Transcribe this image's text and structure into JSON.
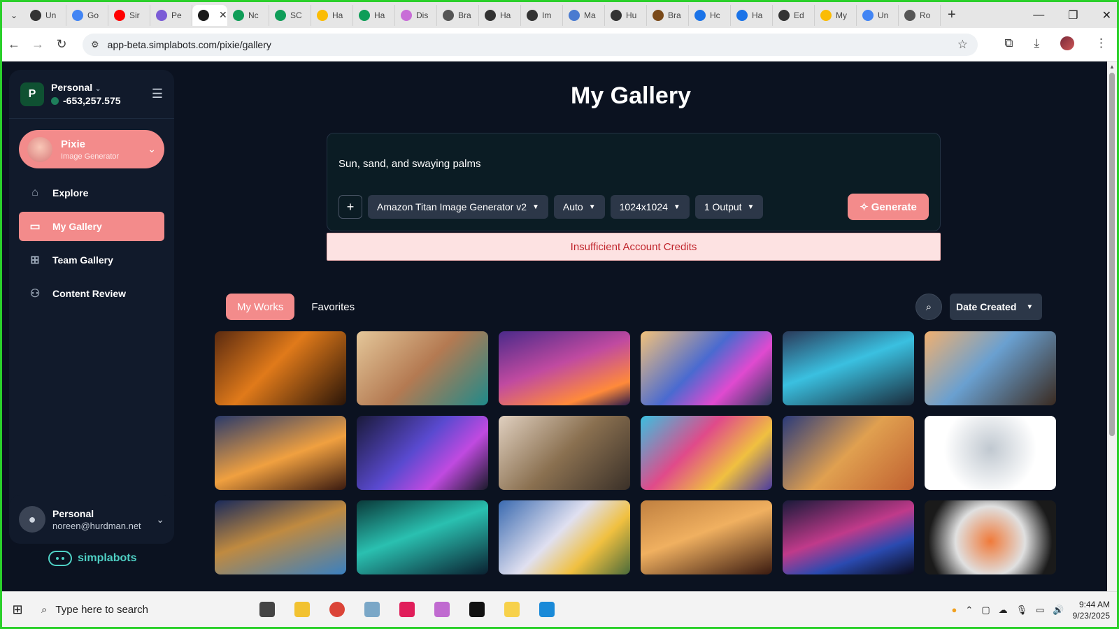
{
  "browser": {
    "tabs": [
      {
        "label": "Un",
        "color": "#333333"
      },
      {
        "label": "Go",
        "color": "#4285f4"
      },
      {
        "label": "Sir",
        "color": "#ff0000"
      },
      {
        "label": "Pe",
        "color": "#7b5cd6"
      },
      {
        "label": "",
        "color": "#1a1a1a",
        "active": true
      },
      {
        "label": "Nc",
        "color": "#0f9d58"
      },
      {
        "label": "SC",
        "color": "#0f9d58"
      },
      {
        "label": "Ha",
        "color": "#fbbc04"
      },
      {
        "label": "Ha",
        "color": "#0f9d58"
      },
      {
        "label": "Dis",
        "color": "#c86dd7"
      },
      {
        "label": "Bra",
        "color": "#555555"
      },
      {
        "label": "Ha",
        "color": "#333333"
      },
      {
        "label": "Im",
        "color": "#333333"
      },
      {
        "label": "Ma",
        "color": "#4a7bd0"
      },
      {
        "label": "Hu",
        "color": "#333333"
      },
      {
        "label": "Bra",
        "color": "#7a4a1a"
      },
      {
        "label": "Hc",
        "color": "#1a73e8"
      },
      {
        "label": "Ha",
        "color": "#1a73e8"
      },
      {
        "label": "Ed",
        "color": "#333333"
      },
      {
        "label": "My",
        "color": "#fbbc04"
      },
      {
        "label": "Un",
        "color": "#4285f4"
      },
      {
        "label": "Ro",
        "color": "#555555"
      }
    ],
    "url": "app-beta.simplabots.com/pixie/gallery"
  },
  "sidebar": {
    "workspace_initial": "P",
    "workspace_name": "Personal",
    "credits": "-653,257.575",
    "bot_name": "Pixie",
    "bot_subtitle": "Image Generator",
    "nav": [
      {
        "label": "Explore",
        "icon": "home-icon",
        "glyph": "⌂"
      },
      {
        "label": "My Gallery",
        "icon": "folder-icon",
        "glyph": "▭",
        "active": true
      },
      {
        "label": "Team Gallery",
        "icon": "folder-plus-icon",
        "glyph": "⊞"
      },
      {
        "label": "Content Review",
        "icon": "users-icon",
        "glyph": "⚇"
      }
    ],
    "user_name": "Personal",
    "user_email": "noreen@hurdman.net",
    "brand": "simplabots"
  },
  "main": {
    "title": "My Gallery",
    "prompt": "Sun, sand, and swaying palms",
    "model": "Amazon Titan Image Generator v2",
    "style": "Auto",
    "size": "1024x1024",
    "outputs": "1 Output",
    "generate_label": "Generate",
    "alert": "Insufficient Account Credits",
    "tab_works": "My Works",
    "tab_favorites": "Favorites",
    "sort_label": "Date Created",
    "accent_color": "#f38b8b"
  },
  "gallery": [
    {
      "name": "thumb-pumpkin-books",
      "bg": "linear-gradient(135deg,#5a2a10,#e07a1a 45%,#2a1508)"
    },
    {
      "name": "thumb-desert-warrior",
      "bg": "linear-gradient(135deg,#e4c79a,#b47a52 50%,#1f8a8a)"
    },
    {
      "name": "thumb-jellyfish-city",
      "bg": "linear-gradient(160deg,#4b2a8a,#c04aa0 45%,#ff8a3a 80%,#2a1a4a)"
    },
    {
      "name": "thumb-music-garage",
      "bg": "linear-gradient(135deg,#f3c27a,#4a6ad0 45%,#e04ad0 70%,#2a3a5a)"
    },
    {
      "name": "thumb-smart-house",
      "bg": "linear-gradient(160deg,#2a3a5a,#3ac0e0 45%,#1a2a3a)"
    },
    {
      "name": "thumb-smart-garage",
      "bg": "linear-gradient(135deg,#f0b070,#6aa0d0 45%,#3a2a20)"
    },
    {
      "name": "thumb-garage-sunset",
      "bg": "linear-gradient(160deg,#2a3a6a,#f0a040 55%,#3a1a10)"
    },
    {
      "name": "thumb-neon-house",
      "bg": "linear-gradient(135deg,#1a1a3a,#5a4ad0 45%,#c04ae0 70%,#1a1a2a)"
    },
    {
      "name": "thumb-robot-horse",
      "bg": "linear-gradient(135deg,#e0d0c0,#8a7050 50%,#3a3028)"
    },
    {
      "name": "thumb-pixel-city",
      "bg": "linear-gradient(135deg,#3ac0e0,#e04a8a 40%,#f0c040 70%,#4a3aa0)"
    },
    {
      "name": "thumb-painted-face",
      "bg": "linear-gradient(135deg,#2a3a7a,#e0a050 50%,#c06030)"
    },
    {
      "name": "thumb-robot-flowers",
      "bg": "radial-gradient(circle at 50% 45%,#c0c8d0,#ffffff 60%)"
    },
    {
      "name": "thumb-astronaut-dog",
      "bg": "linear-gradient(160deg,#1a2a5a,#c08a40 45%,#3a80c0)"
    },
    {
      "name": "thumb-glowing-forest",
      "bg": "linear-gradient(160deg,#0a3a3a,#2ac0b0 45%,#0a2030)"
    },
    {
      "name": "thumb-crystal-dragon",
      "bg": "linear-gradient(135deg,#3a6ab0,#e0e0f0 45%,#f0c040 70%,#4a6a3a)"
    },
    {
      "name": "thumb-snow-cabin",
      "bg": "linear-gradient(160deg,#c08040,#f0b060 45%,#3a1a10)"
    },
    {
      "name": "thumb-cyber-street",
      "bg": "linear-gradient(160deg,#1a1a3a,#c03a8a 45%,#2a4ab0 70%,#0a0a1a)"
    },
    {
      "name": "thumb-sushi-plate",
      "bg": "radial-gradient(circle at 50% 55%,#f07a3a,#e0e0e0 45%,#1a1a1a 80%)"
    }
  ],
  "taskbar": {
    "search_placeholder": "Type here to search",
    "time": "9:44 AM",
    "date": "9/23/2025"
  }
}
